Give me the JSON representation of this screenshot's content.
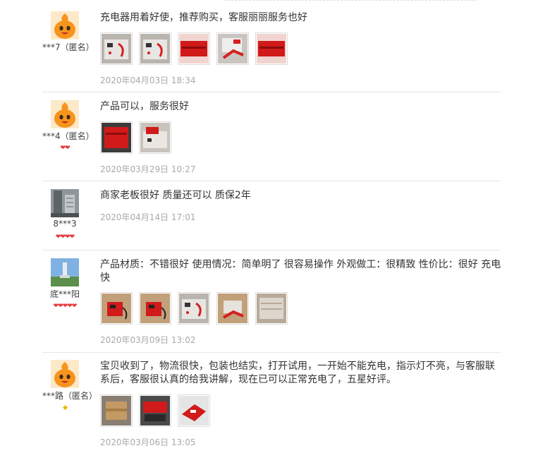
{
  "reviews": [
    {
      "user": "***7（匿名）",
      "avatar": "orange-mascot",
      "rank_icon": "",
      "text": "充电器用着好使，推荐购买，客服丽丽服务也好",
      "photos": [
        "charger-front",
        "charger-front",
        "red-case",
        "charger-clamps",
        "red-case"
      ],
      "date": "2020年04月03日 18:34"
    },
    {
      "user": "***4（匿名）",
      "avatar": "orange-mascot",
      "rank_icon": "❤❤",
      "text": "产品可以，服务很好",
      "photos": [
        "red-case",
        "charger-front"
      ],
      "date": "2020年03月29日 10:27"
    },
    {
      "user": "8***3",
      "avatar": "building-photo",
      "rank_icon": "❤❤❤❤",
      "text": "商家老板很好 质量还可以 质保2年",
      "photos": [],
      "date": "2020年04月14日 17:01"
    },
    {
      "user": "底***阳",
      "avatar": "landscape-photo",
      "rank_icon": "❤❤❤❤❤",
      "text": "产品材质：不错很好 使用情况：简单明了 很容易操作 外观做工：很精致 性价比：很好 充电快",
      "photos": [
        "charger-floor",
        "charger-floor",
        "charger-front",
        "charger-clamps",
        "white-box"
      ],
      "date": "2020年03月09日 13:02"
    },
    {
      "user": "***路（匿名）",
      "avatar": "orange-mascot",
      "rank_icon": "◆",
      "text": "宝贝收到了，物流很快，包装也结实，打开试用，一开始不能充电，指示灯不亮，与客服联系后，客服很认真的给我讲解，现在已可以正常充电了，五星好评。",
      "photos": [
        "parcel",
        "charger-clamps",
        "red-case"
      ],
      "date": "2020年03月06日 13:05"
    }
  ]
}
